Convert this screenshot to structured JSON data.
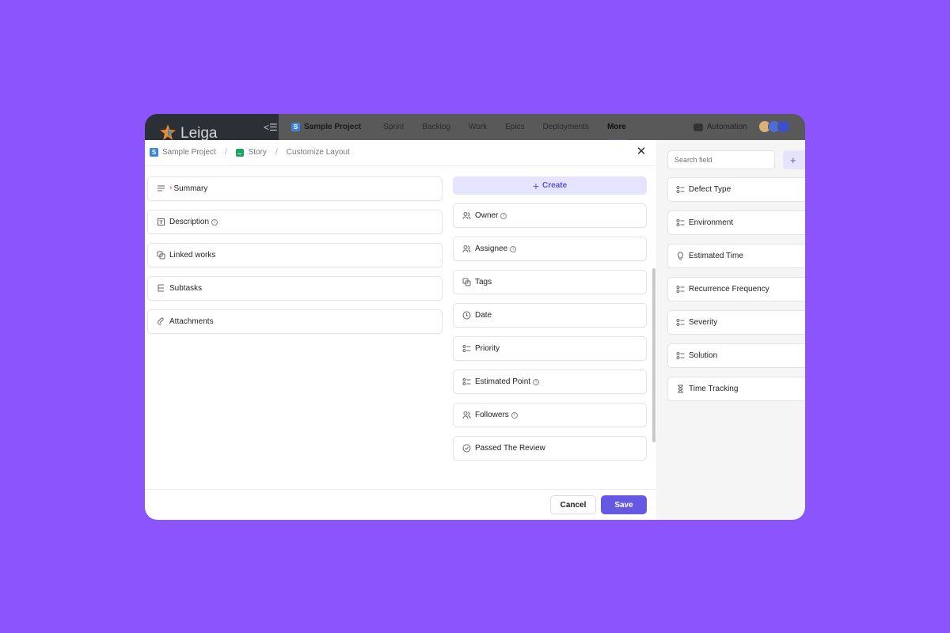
{
  "app": {
    "brand": "Leiga",
    "project_name": "Sample Project",
    "project_badge": "S",
    "nav": [
      "Sprint",
      "Backlog",
      "Work",
      "Epics",
      "Deployments",
      "More"
    ],
    "active_nav": "More",
    "automation_label": "Automation"
  },
  "breadcrumb": {
    "project": "Sample Project",
    "project_badge": "S",
    "type": "Story",
    "page": "Customize Layout"
  },
  "left_fields": [
    {
      "label": "Summary",
      "icon": "lines-icon",
      "required": true
    },
    {
      "label": "Description",
      "icon": "description-icon",
      "info": true
    },
    {
      "label": "Linked works",
      "icon": "link-copy-icon"
    },
    {
      "label": "Subtasks",
      "icon": "tree-icon"
    },
    {
      "label": "Attachments",
      "icon": "paperclip-icon"
    }
  ],
  "create_label": "Create",
  "middle_fields": [
    {
      "label": "Owner",
      "icon": "users-icon",
      "info": true
    },
    {
      "label": "Assignee",
      "icon": "users-icon",
      "info": true
    },
    {
      "label": "Tags",
      "icon": "tags-icon"
    },
    {
      "label": "Date",
      "icon": "clock-icon"
    },
    {
      "label": "Priority",
      "icon": "select-icon"
    },
    {
      "label": "Estimated Point",
      "icon": "select-icon",
      "info": true
    },
    {
      "label": "Followers",
      "icon": "users-icon",
      "info": true
    },
    {
      "label": "Passed The Review",
      "icon": "check-circle-icon"
    }
  ],
  "footer": {
    "cancel": "Cancel",
    "save": "Save"
  },
  "right_panel": {
    "search_placeholder": "Search field",
    "add_label": "+",
    "fields": [
      {
        "label": "Defect Type",
        "icon": "select-icon"
      },
      {
        "label": "Environment",
        "icon": "select-icon"
      },
      {
        "label": "Estimated Time",
        "icon": "bulb-icon"
      },
      {
        "label": "Recurrence Frequency",
        "icon": "select-icon"
      },
      {
        "label": "Severity",
        "icon": "select-icon"
      },
      {
        "label": "Solution",
        "icon": "select-icon"
      },
      {
        "label": "Time Tracking",
        "icon": "hourglass-icon"
      }
    ]
  },
  "colors": {
    "background": "#8b54fc",
    "accent": "#6558e3",
    "accent_light": "#e6e3fc"
  }
}
